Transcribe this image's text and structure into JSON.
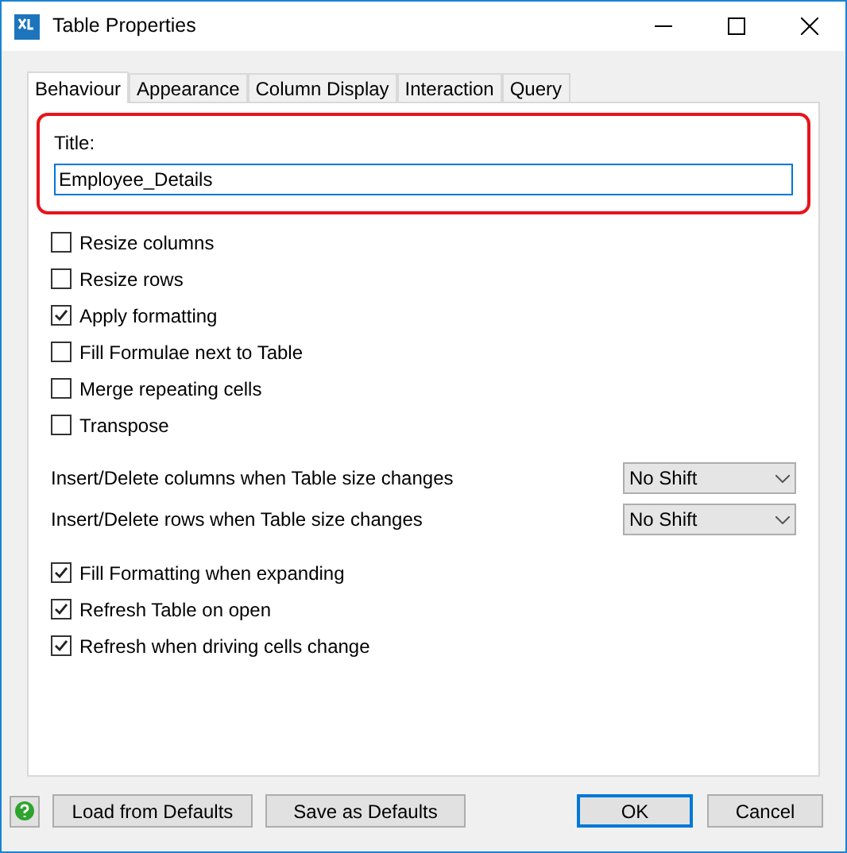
{
  "window": {
    "title": "Table Properties"
  },
  "tabs": [
    {
      "label": "Behaviour",
      "selected": true
    },
    {
      "label": "Appearance",
      "selected": false
    },
    {
      "label": "Column Display",
      "selected": false
    },
    {
      "label": "Interaction",
      "selected": false
    },
    {
      "label": "Query",
      "selected": false
    }
  ],
  "title_field": {
    "label": "Title:",
    "value": "Employee_Details",
    "highlighted": true
  },
  "options_top": [
    {
      "label": "Resize columns",
      "checked": false
    },
    {
      "label": "Resize rows",
      "checked": false
    },
    {
      "label": "Apply formatting",
      "checked": true
    },
    {
      "label": "Fill Formulae next to Table",
      "checked": false
    },
    {
      "label": "Merge repeating cells",
      "checked": false
    },
    {
      "label": "Transpose",
      "checked": false
    }
  ],
  "shift_settings": [
    {
      "label": "Insert/Delete columns when Table size changes",
      "value": "No Shift"
    },
    {
      "label": "Insert/Delete rows when Table size changes",
      "value": "No Shift"
    }
  ],
  "options_bottom": [
    {
      "label": "Fill Formatting when expanding",
      "checked": true
    },
    {
      "label": "Refresh Table on open",
      "checked": true
    },
    {
      "label": "Refresh when driving cells change",
      "checked": true
    }
  ],
  "footer_buttons": [
    {
      "label": "Load from Defaults",
      "default": false
    },
    {
      "label": "Save as Defaults",
      "default": false
    }
  ],
  "dialog_buttons": [
    {
      "label": "OK",
      "default": true
    },
    {
      "label": "Cancel",
      "default": false
    }
  ]
}
